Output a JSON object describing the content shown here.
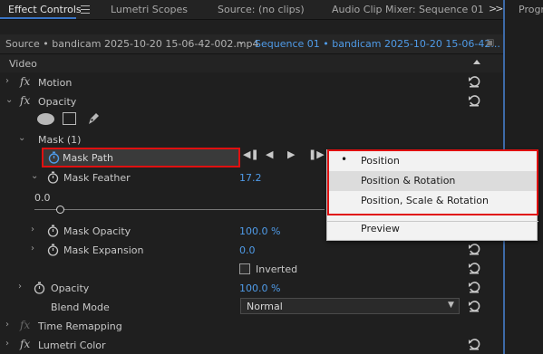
{
  "tabs": [
    {
      "label": "Effect Controls",
      "active": true
    },
    {
      "label": "Lumetri Scopes",
      "active": false
    },
    {
      "label": "Source: (no clips)",
      "active": false
    },
    {
      "label": "Audio Clip Mixer: Sequence 01",
      "active": false
    }
  ],
  "overflow_icon": "double-chevron-right",
  "right_panel": {
    "tab_label": "Progr"
  },
  "source_bar": {
    "source_label": "Source • bandicam 2025-10-20 15-06-42-002.mp4",
    "sequence_label": "Sequence 01 • bandicam 2025-10-20 15-06-42..."
  },
  "section": {
    "label": "Video"
  },
  "rows": {
    "motion": "Motion",
    "opacity_effect": "Opacity",
    "mask_group": "Mask (1)",
    "mask_path": "Mask Path",
    "mask_feather": "Mask Feather",
    "mask_feather_value": "17.2",
    "slider_min": "0.0",
    "mask_opacity": "Mask Opacity",
    "mask_opacity_value": "100.0 %",
    "mask_expansion": "Mask Expansion",
    "mask_expansion_value": "0.0",
    "inverted_label": "Inverted",
    "opacity_param": "Opacity",
    "opacity_value": "100.0 %",
    "blend_mode": "Blend Mode",
    "blend_value": "Normal",
    "time_remapping": "Time Remapping",
    "lumetri_color": "Lumetri Color"
  },
  "fx_symbol": "fx",
  "popup_menu": {
    "items": [
      "Position",
      "Position & Rotation",
      "Position, Scale & Rotation"
    ],
    "selected_index": 0,
    "hover_index": 1,
    "preview": "Preview",
    "bullet": "•"
  },
  "colors": {
    "accent_blue": "#4f9be8",
    "highlight_red": "#e01010",
    "tab_underline": "#3a74c4"
  }
}
